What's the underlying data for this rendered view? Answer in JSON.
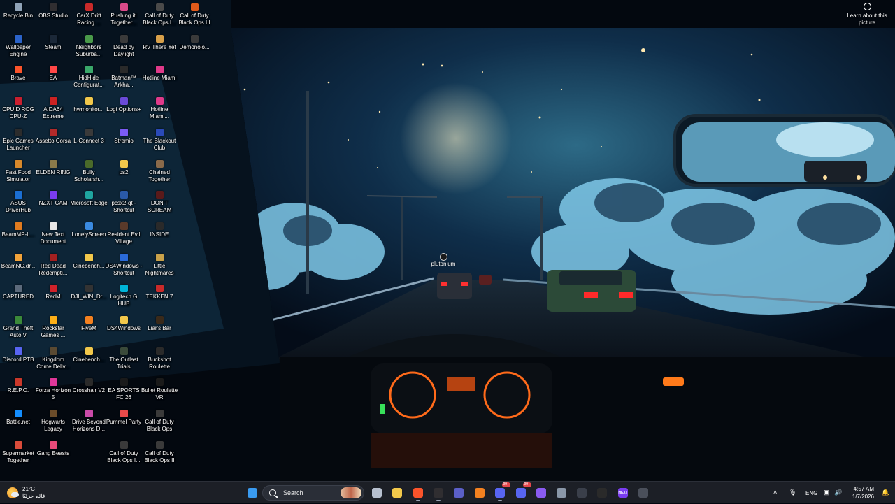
{
  "screen": {
    "title": "Windows desktop"
  },
  "learn_more": {
    "label": "Learn about this picture"
  },
  "desktop_overlay": {
    "label": "plutonium"
  },
  "desktop_icons": [
    [
      {
        "label": "Recycle Bin",
        "color": "#8fa3b8"
      },
      {
        "label": "Wallpaper Engine",
        "color": "#2b63c9"
      },
      {
        "label": "Brave",
        "color": "#fb542b"
      },
      {
        "label": "CPUID ROG CPU-Z",
        "color": "#c91f2f"
      },
      {
        "label": "Epic Games Launcher",
        "color": "#2c2c2c"
      },
      {
        "label": "Fast Food Simulator",
        "color": "#d8892b"
      },
      {
        "label": "ASUS DriverHub",
        "color": "#1b6fd3"
      },
      {
        "label": "BeamMP-L...",
        "color": "#e07b1f"
      },
      {
        "label": "BeamNG.dr...",
        "color": "#f2a33a"
      },
      {
        "label": "CAPTURED",
        "color": "#5c6a7b"
      },
      {
        "label": "Grand Theft Auto V",
        "color": "#3b8a3a"
      },
      {
        "label": "Discord PTB",
        "color": "#5865f2"
      },
      {
        "label": "R.E.P.O.",
        "color": "#c9382b"
      },
      {
        "label": "Battle.net",
        "color": "#148eff"
      },
      {
        "label": "Supermarket Together",
        "color": "#d94b3a"
      }
    ],
    [
      {
        "label": "OBS Studio",
        "color": "#302e31"
      },
      {
        "label": "Steam",
        "color": "#1b2838"
      },
      {
        "label": "EA",
        "color": "#ff4747"
      },
      {
        "label": "AIDA64 Extreme",
        "color": "#cc2222"
      },
      {
        "label": "Assetto Corsa",
        "color": "#b22a2a"
      },
      {
        "label": "ELDEN RING",
        "color": "#8a7a4a"
      },
      {
        "label": "NZXT CAM",
        "color": "#7a3cf0"
      },
      {
        "label": "New Text Document",
        "color": "#e8e8e8"
      },
      {
        "label": "Red Dead Redempti...",
        "color": "#a32020"
      },
      {
        "label": "RedM",
        "color": "#d0222a"
      },
      {
        "label": "Rockstar Games ...",
        "color": "#fcaf17"
      },
      {
        "label": "Kingdom Come Deliv...",
        "color": "#5a4a32"
      },
      {
        "label": "Forza Horizon 5",
        "color": "#e0379a"
      },
      {
        "label": "Hogwarts Legacy",
        "color": "#6b4c2a"
      },
      {
        "label": "Gang Beasts",
        "color": "#e84a7a"
      }
    ],
    [
      {
        "label": "CarX Drift Racing ...",
        "color": "#c92a2a"
      },
      {
        "label": "Neighbors Suburba...",
        "color": "#4a9a4a"
      },
      {
        "label": "HidHide Configurat...",
        "color": "#3aa86a"
      },
      {
        "label": "hwmonitor...",
        "color": "#f2c84b"
      },
      {
        "label": "L-Connect 3",
        "color": "#3a3a3a"
      },
      {
        "label": "Bully Scholarsh...",
        "color": "#4a6a2a"
      },
      {
        "label": "Microsoft Edge",
        "color": "#1fa5a0"
      },
      {
        "label": "LonelyScreen",
        "color": "#3a8ae0"
      },
      {
        "label": "Cinebench...",
        "color": "#f2c84b"
      },
      {
        "label": "DJI_WIN_Dr...",
        "color": "#333333"
      },
      {
        "label": "FiveM",
        "color": "#f48120"
      },
      {
        "label": "Cinebench...",
        "color": "#f2c84b"
      },
      {
        "label": "Crosshair V2",
        "color": "#2a2a2a"
      },
      {
        "label": "Drive Beyond Horizons D...",
        "color": "#c94aa8"
      }
    ],
    [
      {
        "label": "Pushing it! Together...",
        "color": "#d94a8a"
      },
      {
        "label": "Dead by Daylight",
        "color": "#3a3a3a"
      },
      {
        "label": "Batman™ Arkha...",
        "color": "#2a2a2a"
      },
      {
        "label": "Logi Options+",
        "color": "#6a4ad8"
      },
      {
        "label": "Stremio",
        "color": "#7b5bf5"
      },
      {
        "label": "ps2",
        "color": "#f2c84b"
      },
      {
        "label": "pcsx2-qt - Shortcut",
        "color": "#2a5aa8"
      },
      {
        "label": "Resident Evil Village",
        "color": "#5a3a2a"
      },
      {
        "label": "DS4Windows - Shortcut",
        "color": "#2a6ad8"
      },
      {
        "label": "Logitech G HUB",
        "color": "#00b4d8"
      },
      {
        "label": "DS4Windows",
        "color": "#f2c84b"
      },
      {
        "label": "The Outlast Trials",
        "color": "#3a4a3a"
      },
      {
        "label": "EA SPORTS FC 26",
        "color": "#1a1a1a"
      },
      {
        "label": "Pummel Party",
        "color": "#e84a4a"
      },
      {
        "label": "Call of Duty Black Ops I...",
        "color": "#3a3a3a"
      }
    ],
    [
      {
        "label": "Call of Duty Black Ops I...",
        "color": "#4a4a4a"
      },
      {
        "label": "RV There Yet",
        "color": "#d8a04a"
      },
      {
        "label": "Hotline Miami",
        "color": "#e03a8a"
      },
      {
        "label": "Hotline Miami...",
        "color": "#e03a8a"
      },
      {
        "label": "The Blackout Club",
        "color": "#2a4ab8"
      },
      {
        "label": "Chained Together",
        "color": "#8a6a4a"
      },
      {
        "label": "DON'T SCREAM",
        "color": "#5a1a1a"
      },
      {
        "label": "INSIDE",
        "color": "#2a2a2a"
      },
      {
        "label": "Little Nightmares",
        "color": "#c9a24a"
      },
      {
        "label": "TEKKEN 7",
        "color": "#c92a2a"
      },
      {
        "label": "Liar's Bar",
        "color": "#3a2a1a"
      },
      {
        "label": "Buckshot Roulette",
        "color": "#2a2a2a"
      },
      {
        "label": "Bullet Roulette VR",
        "color": "#1a1a1a"
      },
      {
        "label": "Call of Duty Black Ops",
        "color": "#3a3a3a"
      },
      {
        "label": "Call of Duty Black Ops II",
        "color": "#3a3a3a"
      }
    ],
    [
      {
        "label": "Call of Duty Black Ops III",
        "color": "#e05a1a"
      },
      {
        "label": "Demonolo...",
        "color": "#3a3a3a"
      }
    ]
  ],
  "weather": {
    "temperature": "21°C",
    "description": "غائم جزئيًا"
  },
  "taskbar": {
    "search_label": "Search",
    "apps": [
      {
        "icon": "windows-start-icon",
        "color": "#3a9bf0",
        "active": false
      },
      {
        "icon": "task-view-icon",
        "color": "#b7c0cf",
        "active": false
      },
      {
        "icon": "file-explorer-icon",
        "color": "#f2c84b",
        "active": false
      },
      {
        "icon": "brave-icon",
        "color": "#fb542b",
        "active": true
      },
      {
        "icon": "obs-icon",
        "color": "#302e31",
        "active": true
      },
      {
        "icon": "teams-icon",
        "color": "#5b5fc7",
        "active": false
      },
      {
        "icon": "aida64-icon",
        "color": "#f48120",
        "active": false
      },
      {
        "icon": "discord-icon",
        "color": "#5865f2",
        "active": true,
        "badge": "99+"
      },
      {
        "icon": "discord-ptb-icon",
        "color": "#5865f2",
        "active": false,
        "badge": "99+"
      },
      {
        "icon": "gamepad-icon",
        "color": "#8a5bf0",
        "active": false
      },
      {
        "icon": "settings-icon",
        "color": "#8a97a8",
        "active": false
      },
      {
        "icon": "terminal-icon",
        "color": "#3a3f4a",
        "active": false
      },
      {
        "icon": "rockstar-icon",
        "color": "#2a2a2a",
        "active": false
      },
      {
        "icon": "nzxt-icon",
        "color": "#7a3cf0",
        "active": false,
        "text": "NEXT"
      },
      {
        "icon": "xbox-icon",
        "color": "#4a4f5a",
        "active": false
      }
    ]
  },
  "tray": {
    "language": "ENG",
    "time": "4:57 AM",
    "date": "1/7/2026"
  }
}
